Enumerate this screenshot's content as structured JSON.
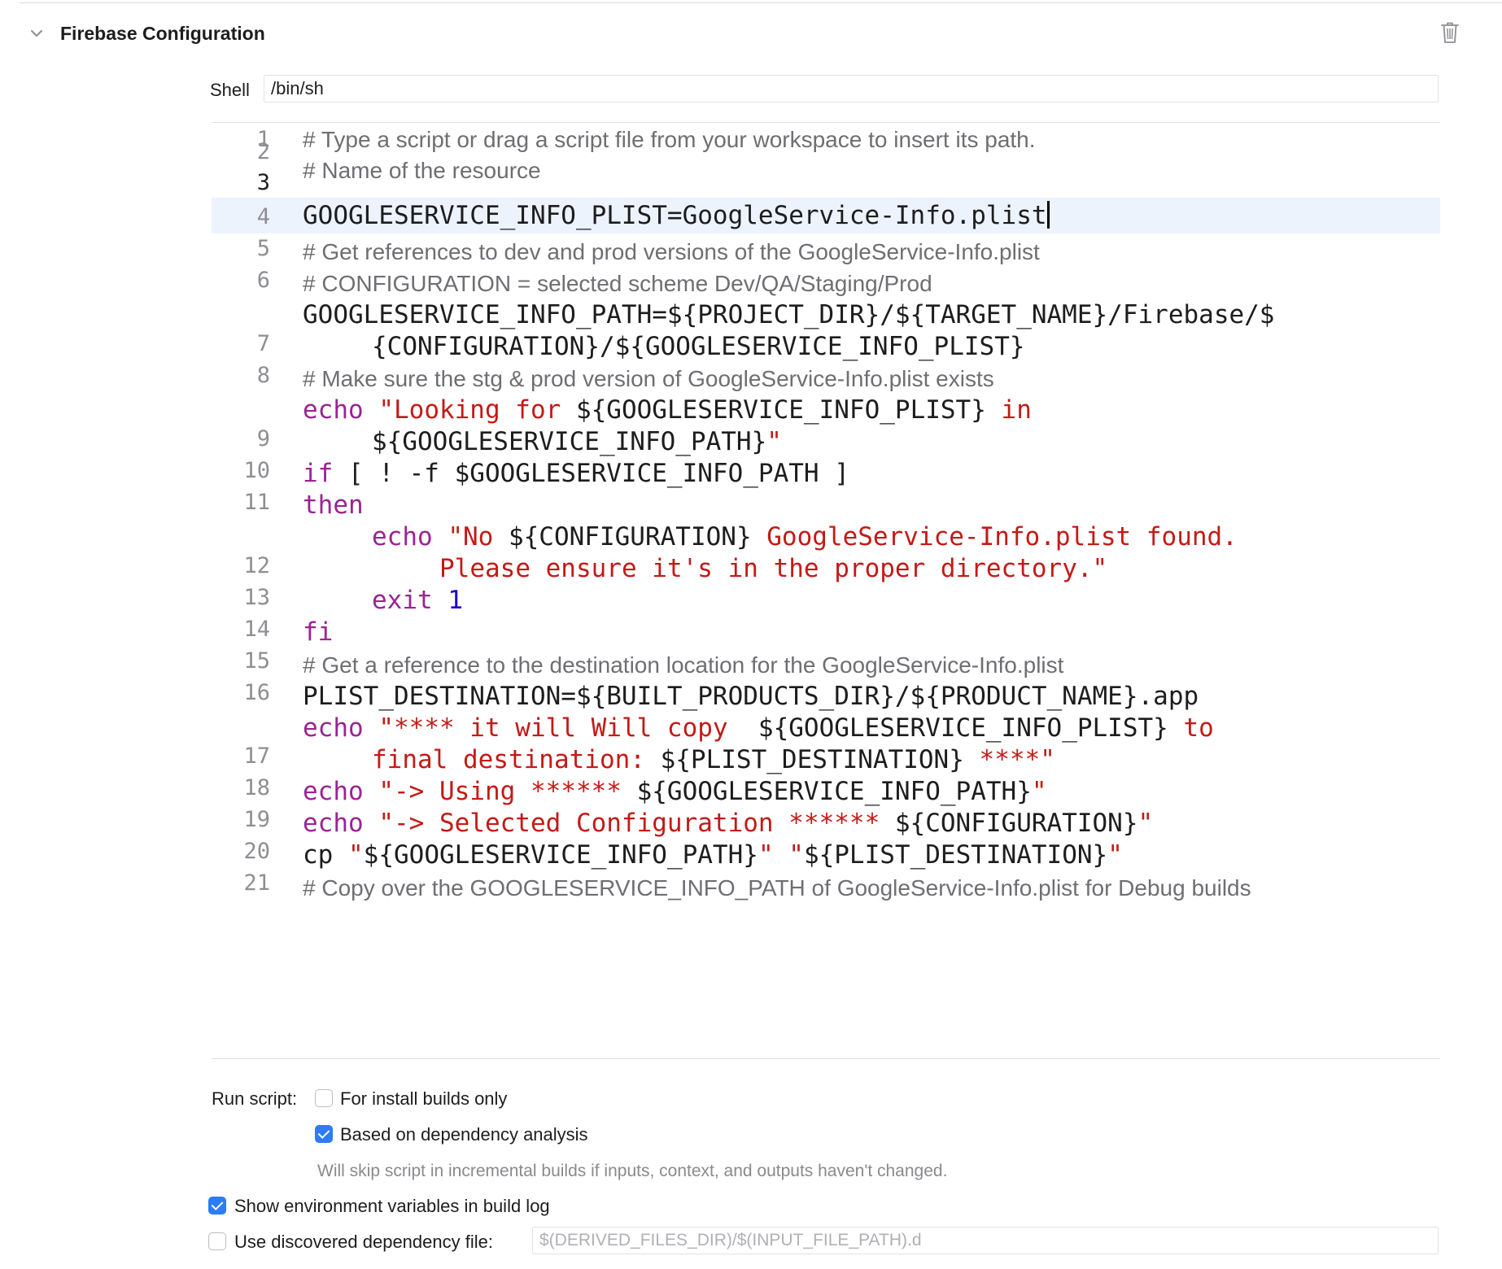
{
  "phase": {
    "title": "Firebase Configuration",
    "collapse_icon": "chevron-down-icon",
    "delete_icon": "trash-icon"
  },
  "shell": {
    "label": "Shell",
    "value": "/bin/sh"
  },
  "editor": {
    "current_line": "3",
    "lines": [
      {
        "number": "1",
        "comment": "# Type a script or drag a script file from your workspace to insert its path."
      },
      {
        "number": "2",
        "comment": "# Name of the resource"
      },
      {
        "number": "3",
        "code": "GOOGLESERVICE_INFO_PLIST=GoogleService-Info.plist"
      },
      {
        "number": "4",
        "comment": "# Get references to dev and prod versions of the GoogleService-Info.plist"
      },
      {
        "number": "5",
        "comment": "# CONFIGURATION = selected scheme Dev/QA/Staging/Prod"
      },
      {
        "number": "6",
        "code_a": "GOOGLESERVICE_INFO_PATH=${PROJECT_DIR}/${TARGET_NAME}/Firebase/$",
        "code_b": "{CONFIGURATION}/${GOOGLESERVICE_INFO_PLIST}"
      },
      {
        "number": "7",
        "comment": "# Make sure the stg & prod version of GoogleService-Info.plist exists"
      },
      {
        "number": "8",
        "kw": "echo",
        "s1": "\"Looking for ",
        "v1": "${GOOGLESERVICE_INFO_PLIST}",
        "s2": " in",
        "v2": "${GOOGLESERVICE_INFO_PATH}",
        "s3": "\""
      },
      {
        "number": "9",
        "kw": "if",
        "code": " [ ! -f $GOOGLESERVICE_INFO_PATH ]"
      },
      {
        "number": "10",
        "kw": "then"
      },
      {
        "number": "11",
        "kw": "echo",
        "s1": "\"No ",
        "v1": "${CONFIGURATION}",
        "s2": " GoogleService-Info.plist found.",
        "s3": "Please ensure it's in the proper directory.\""
      },
      {
        "number": "12",
        "kw": "exit",
        "num": "1"
      },
      {
        "number": "13",
        "kw": "fi"
      },
      {
        "number": "14",
        "comment": "# Get a reference to the destination location for the GoogleService-Info.plist"
      },
      {
        "number": "15",
        "code": "PLIST_DESTINATION=${BUILT_PRODUCTS_DIR}/${PRODUCT_NAME}.app"
      },
      {
        "number": "16",
        "kw": "echo",
        "s1": "\"**** it will Will copy  ",
        "v1": "${GOOGLESERVICE_INFO_PLIST}",
        "s2": " to",
        "s3": "final destination: ",
        "v2": "${PLIST_DESTINATION}",
        "s4": " ****\""
      },
      {
        "number": "17",
        "kw": "echo",
        "s1": "\"-> Using ****** ",
        "v1": "${GOOGLESERVICE_INFO_PATH}",
        "s2": "\""
      },
      {
        "number": "18",
        "kw": "echo",
        "s1": "\"-> Selected Configuration ****** ",
        "v1": "${CONFIGURATION}",
        "s2": "\""
      },
      {
        "number": "19",
        "cmd": "cp ",
        "s1": "\"",
        "v1": "${GOOGLESERVICE_INFO_PATH}",
        "s2": "\" \"",
        "v2": "${PLIST_DESTINATION}",
        "s3": "\""
      },
      {
        "number": "20",
        "comment": "# Copy over the GOOGLESERVICE_INFO_PATH of GoogleService-Info.plist for Debug builds"
      },
      {
        "number": "21"
      }
    ]
  },
  "options": {
    "run_script_label": "Run script:",
    "install_builds_only": {
      "label": "For install builds only",
      "checked": false
    },
    "dependency_analysis": {
      "label": "Based on dependency analysis",
      "checked": true
    },
    "dependency_note": "Will skip script in incremental builds if inputs, context, and outputs haven't changed.",
    "show_env_vars": {
      "label": "Show environment variables in build log",
      "checked": true
    },
    "discovered_dep_file": {
      "label": "Use discovered dependency file:",
      "checked": false,
      "placeholder": "$(DERIVED_FILES_DIR)/$(INPUT_FILE_PATH).d"
    }
  },
  "colors": {
    "keyword": "#9b2393",
    "string": "#c41a16",
    "number": "#1c00cf",
    "comment": "#6e6e73",
    "current_line_bg": "#ecf3fd",
    "checkbox_accent": "#2c7cf6"
  }
}
